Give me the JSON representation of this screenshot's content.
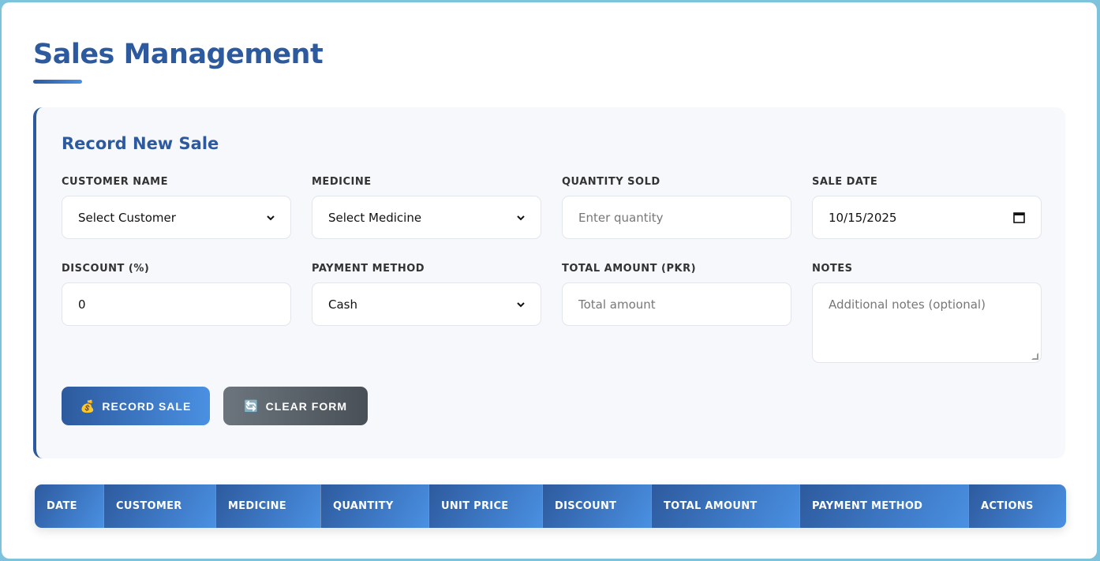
{
  "page": {
    "title": "Sales Management"
  },
  "form": {
    "title": "Record New Sale",
    "fields": {
      "customer": {
        "label": "CUSTOMER NAME",
        "value": "Select Customer"
      },
      "medicine": {
        "label": "MEDICINE",
        "value": "Select Medicine"
      },
      "quantity": {
        "label": "QUANTITY SOLD",
        "placeholder": "Enter quantity"
      },
      "sale_date": {
        "label": "SALE DATE",
        "value": "10/15/2025"
      },
      "discount": {
        "label": "DISCOUNT (%)",
        "value": "0"
      },
      "payment": {
        "label": "PAYMENT METHOD",
        "value": "Cash"
      },
      "total": {
        "label": "TOTAL AMOUNT (PKR)",
        "placeholder": "Total amount"
      },
      "notes": {
        "label": "NOTES",
        "placeholder": "Additional notes (optional)"
      }
    },
    "buttons": {
      "record": {
        "icon": "💰",
        "label": "RECORD SALE"
      },
      "clear": {
        "icon": "🔄",
        "label": "CLEAR FORM"
      }
    }
  },
  "table": {
    "headers": [
      "DATE",
      "CUSTOMER",
      "MEDICINE",
      "QUANTITY",
      "UNIT PRICE",
      "DISCOUNT",
      "TOTAL AMOUNT",
      "PAYMENT METHOD",
      "ACTIONS"
    ]
  },
  "colors": {
    "accent": "#2d5a9e",
    "accent_light": "#4a90e2",
    "secondary": "#6c757d"
  }
}
